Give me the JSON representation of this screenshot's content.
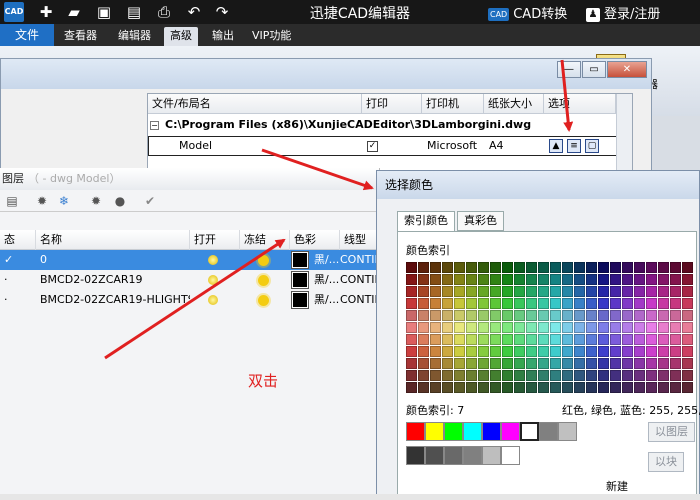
{
  "titlebar": {
    "app_icon": "CAD",
    "title": "迅捷CAD编辑器",
    "cad_convert": "CAD转换",
    "cad_badge": "CAD",
    "login": "登录/注册",
    "icons": [
      "plus-icon",
      "folder-open-icon",
      "save-icon",
      "save-as-icon",
      "print-icon",
      "undo-icon",
      "redo-icon"
    ]
  },
  "menu": {
    "file": "文件",
    "items": [
      "查看器",
      "编辑器",
      "高级",
      "输出",
      "VIP功能"
    ],
    "active": "高级"
  },
  "ribbon": {
    "right_label": "武器"
  },
  "layout_dialog": {
    "columns": [
      "文件/布局名",
      "打印",
      "打印机",
      "纸张大小",
      "选项"
    ],
    "file_path": "C:\\Program Files (x86)\\XunjieCADEditor\\3DLamborgini.dwg",
    "row": {
      "name": "Model",
      "printer": "Microsoft",
      "paper": "A4"
    },
    "expander": "−"
  },
  "layers_panel": {
    "title": "图层",
    "title_faint": "（ - dwg Model）",
    "columns": [
      "态",
      "名称",
      "打开",
      "冻结",
      "色彩",
      "线型"
    ],
    "rows": [
      {
        "state": "✓",
        "name": "0",
        "color_text": "黑/...",
        "linetype": "CONTIN"
      },
      {
        "state": "·",
        "name": "BMCD2-02ZCAR19",
        "color_text": "黑/...",
        "linetype": "CONTIN"
      },
      {
        "state": "·",
        "name": "BMCD2-02ZCAR19-HLIGHTS",
        "color_text": "黑/...",
        "linetype": "CONTIN"
      }
    ]
  },
  "color_dialog": {
    "title": "选择颜色",
    "tabs": [
      "索引颜色",
      "真彩色"
    ],
    "palette_label": "颜色索引",
    "index_label": "颜色索引: 7",
    "rgb_label": "红色, 绿色, 蓝色: 255, 255,",
    "btn_bylayer": "以图层",
    "btn_byblock": "以块",
    "new_label": "新建",
    "standard_colors": [
      "#ff0000",
      "#ffff00",
      "#00ff00",
      "#00ffff",
      "#0000ff",
      "#ff00ff",
      "#ffffff",
      "#808080",
      "#c0c0c0"
    ],
    "grays": [
      "#333333",
      "#505050",
      "#696969",
      "#808080",
      "#bebebe",
      "#ffffff"
    ],
    "selected_index": 6
  },
  "annotation": {
    "text": "双击",
    "color": "#e02020"
  }
}
